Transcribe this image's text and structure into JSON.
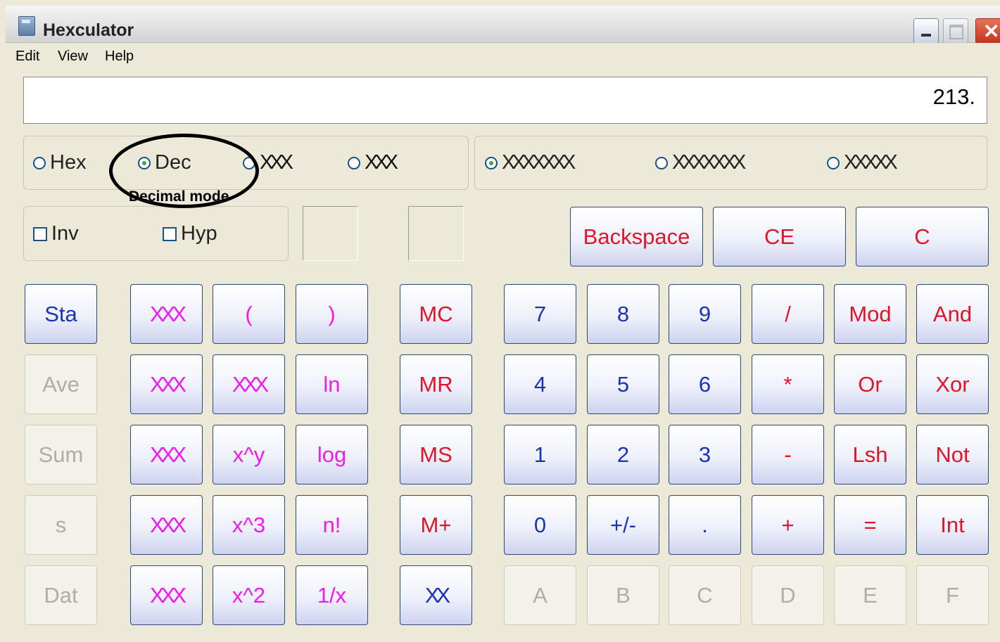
{
  "window": {
    "title": "Hexculator"
  },
  "menu": [
    "Edit",
    "View",
    "Help"
  ],
  "display": {
    "value": "213."
  },
  "base_group": {
    "hex": "Hex",
    "dec": "Dec",
    "opt3": "XXX",
    "opt4": "XXX",
    "selected": "Dec"
  },
  "angle_group": {
    "opt1": "XXXXXXX",
    "opt2": "XXXXXXX",
    "opt3": "XXXXX",
    "selected": "opt1"
  },
  "checkboxes": {
    "inv": "Inv",
    "hyp": "Hyp"
  },
  "annotation": {
    "label": "Decimal mode"
  },
  "edit_buttons": [
    "Backspace",
    "CE",
    "C"
  ],
  "stat_buttons": [
    "Sta",
    "Ave",
    "Sum",
    "s",
    "Dat"
  ],
  "func_col1": [
    "XXX",
    "XXX",
    "XXX",
    "XXX",
    "XXX"
  ],
  "func_col2": [
    "(",
    "XXX",
    "x^y",
    "x^3",
    "x^2"
  ],
  "func_col3": [
    ")",
    "ln",
    "log",
    "n!",
    "1/x"
  ],
  "memory_buttons": [
    "MC",
    "MR",
    "MS",
    "M+",
    "XX"
  ],
  "digit_rows": [
    [
      "7",
      "8",
      "9",
      "/",
      "Mod",
      "And"
    ],
    [
      "4",
      "5",
      "6",
      "*",
      "Or",
      "Xor"
    ],
    [
      "1",
      "2",
      "3",
      "-",
      "Lsh",
      "Not"
    ],
    [
      "0",
      "+/-",
      ".",
      "+",
      "=",
      "Int"
    ],
    [
      "A",
      "B",
      "C",
      "D",
      "E",
      "F"
    ]
  ],
  "colors": {
    "digit": "#1d33b5",
    "operator": "#e0152b",
    "function": "#ee1aee",
    "disabled": "#b0aea3"
  }
}
